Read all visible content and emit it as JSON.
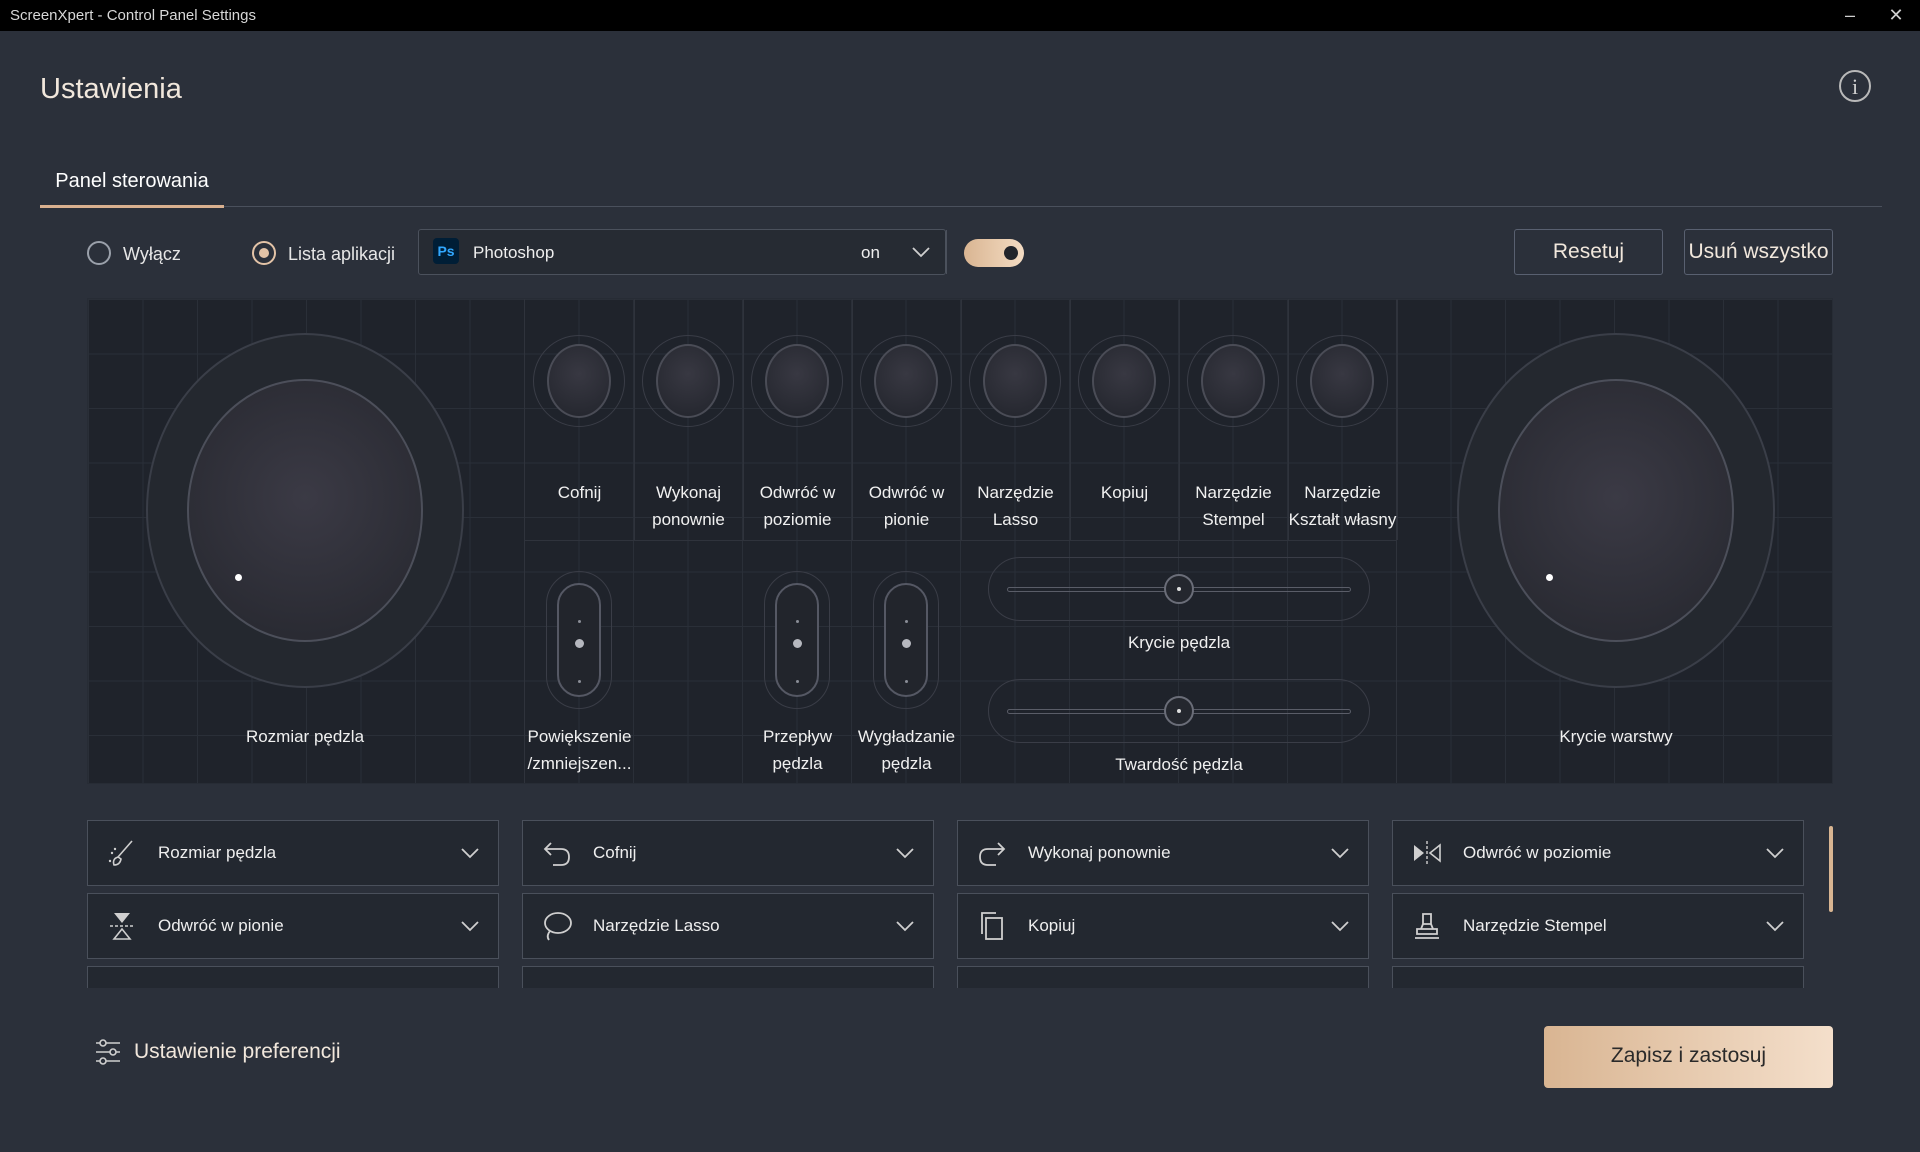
{
  "window": {
    "title": "ScreenXpert - Control Panel Settings",
    "minimize_icon": "minimize-icon",
    "close_icon": "close-icon"
  },
  "header": {
    "title": "Ustawienia",
    "info_icon": "info-icon"
  },
  "tabs": [
    {
      "label": "Panel sterowania",
      "active": true
    }
  ],
  "mode": {
    "options": [
      {
        "label": "Wyłącz",
        "selected": false
      },
      {
        "label": "Lista aplikacji",
        "selected": true
      }
    ],
    "app": {
      "icon": "Ps",
      "name": "Photoshop",
      "state": "on",
      "toggle_on": true
    }
  },
  "actions": {
    "reset": "Resetuj",
    "delete_all": "Usuń wszystko"
  },
  "panel": {
    "left_dial": "Rozmiar pędzla",
    "right_dial": "Krycie warstwy",
    "knobs": [
      "Cofnij",
      "Wykonaj\nponownie",
      "Odwróć w\npoziomie",
      "Odwróć w\npionie",
      "Narzędzie\nLasso",
      "Kopiuj",
      "Narzędzie\nStempel",
      "Narzędzie\nKształt własny"
    ],
    "rockers": [
      {
        "label": "Powiększenie\n/zmniejszen..."
      },
      {
        "label": "Przepływ\npędzla"
      },
      {
        "label": "Wygładzanie\npędzla"
      }
    ],
    "sliders": [
      {
        "label": "Krycie pędzla"
      },
      {
        "label": "Twardość pędzla"
      }
    ]
  },
  "assignments": [
    {
      "label": "Rozmiar pędzla",
      "icon": "brush-icon"
    },
    {
      "label": "Cofnij",
      "icon": "undo-icon"
    },
    {
      "label": "Wykonaj ponownie",
      "icon": "redo-icon"
    },
    {
      "label": "Odwróć w poziomie",
      "icon": "flip-horizontal-icon"
    },
    {
      "label": "Odwróć w pionie",
      "icon": "flip-vertical-icon"
    },
    {
      "label": "Narzędzie Lasso",
      "icon": "lasso-icon"
    },
    {
      "label": "Kopiuj",
      "icon": "copy-icon"
    },
    {
      "label": "Narzędzie Stempel",
      "icon": "stamp-icon"
    }
  ],
  "footer": {
    "preferences": "Ustawienie preferencji",
    "save": "Zapisz i zastosuj"
  },
  "colors": {
    "accent": "#d9b592",
    "background": "#2b303a",
    "panel": "#1f232b",
    "titlebar": "#000000"
  }
}
